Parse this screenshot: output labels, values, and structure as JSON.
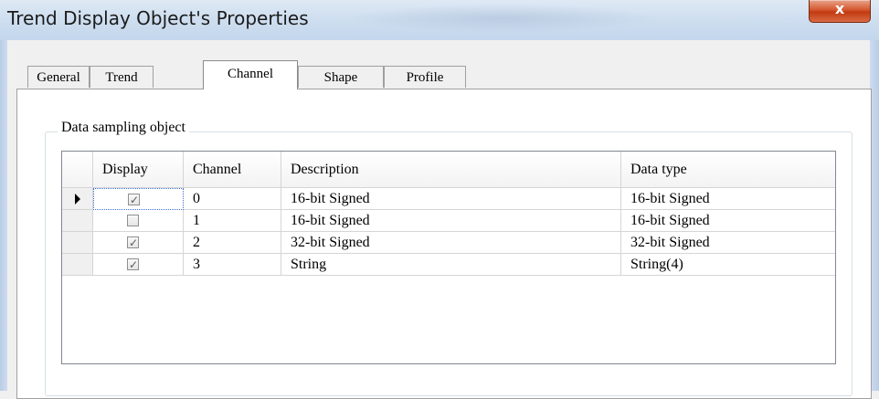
{
  "window": {
    "title": "Trend Display Object's Properties",
    "close_glyph": "x"
  },
  "tabs": [
    {
      "label": "General",
      "active": false
    },
    {
      "label": "Trend",
      "active": false
    },
    {
      "label": "Channel",
      "active": true
    },
    {
      "label": "Shape",
      "active": false
    },
    {
      "label": "Profile",
      "active": false
    }
  ],
  "group": {
    "label": "Data sampling object"
  },
  "table": {
    "columns": [
      "Display",
      "Channel",
      "Description",
      "Data type"
    ],
    "rows": [
      {
        "display": true,
        "channel": "0",
        "description": "16-bit Signed",
        "data_type": "16-bit Signed",
        "current": true
      },
      {
        "display": false,
        "channel": "1",
        "description": "16-bit Signed",
        "data_type": "16-bit Signed",
        "current": false
      },
      {
        "display": true,
        "channel": "2",
        "description": "32-bit Signed",
        "data_type": "32-bit Signed",
        "current": false
      },
      {
        "display": true,
        "channel": "3",
        "description": "String",
        "data_type": "String(4)",
        "current": false
      }
    ]
  },
  "icons": {
    "check": "✓",
    "row_pointer": "triangle-right-icon"
  }
}
